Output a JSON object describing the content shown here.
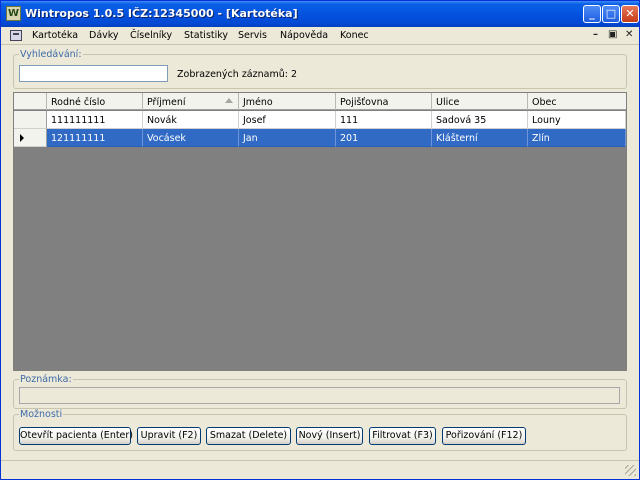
{
  "window": {
    "title": "Wintropos 1.0.5  IČZ:12345000 - [Kartotéka]",
    "app_icon_letter": "W",
    "controls": {
      "minimize": "_",
      "maximize": "□",
      "close": "✕"
    }
  },
  "menu": {
    "items": [
      "Kartotéka",
      "Dávky",
      "Číselníky",
      "Statistiky",
      "Servis",
      "Nápověda",
      "Konec"
    ],
    "mdi_controls": {
      "minimize": "–",
      "restore": "▣",
      "close": "✕"
    }
  },
  "search": {
    "legend": "Vyhledávání:",
    "value": "",
    "placeholder": "",
    "record_count_label": "Zobrazených záznamů: 2"
  },
  "table": {
    "columns": [
      "Rodné číslo",
      "Příjmení",
      "Jméno",
      "Pojišťovna",
      "Ulice",
      "Obec"
    ],
    "sorted_column": "Příjmení",
    "rows": [
      [
        "111111111",
        "Novák",
        "Josef",
        "111",
        "Sadová 35",
        "Louny"
      ],
      [
        "121111111",
        "Vocásek",
        "Jan",
        "201",
        "Klášterní",
        "Zlín"
      ]
    ],
    "selected_row": 1
  },
  "note": {
    "legend": "Poznámka:",
    "value": ""
  },
  "options": {
    "legend": "Možnosti",
    "buttons": [
      "Otevřít pacienta (Enter)",
      "Upravit (F2)",
      "Smazat (Delete)",
      "Nový (Insert)",
      "Filtrovat (F3)",
      "Pořizování (F12)"
    ]
  },
  "colors": {
    "titlebar": "#0553e0",
    "selection": "#316ac5",
    "grid_background": "#808080",
    "window_background": "#ece9d8",
    "legend_text": "#3d6aa8"
  }
}
